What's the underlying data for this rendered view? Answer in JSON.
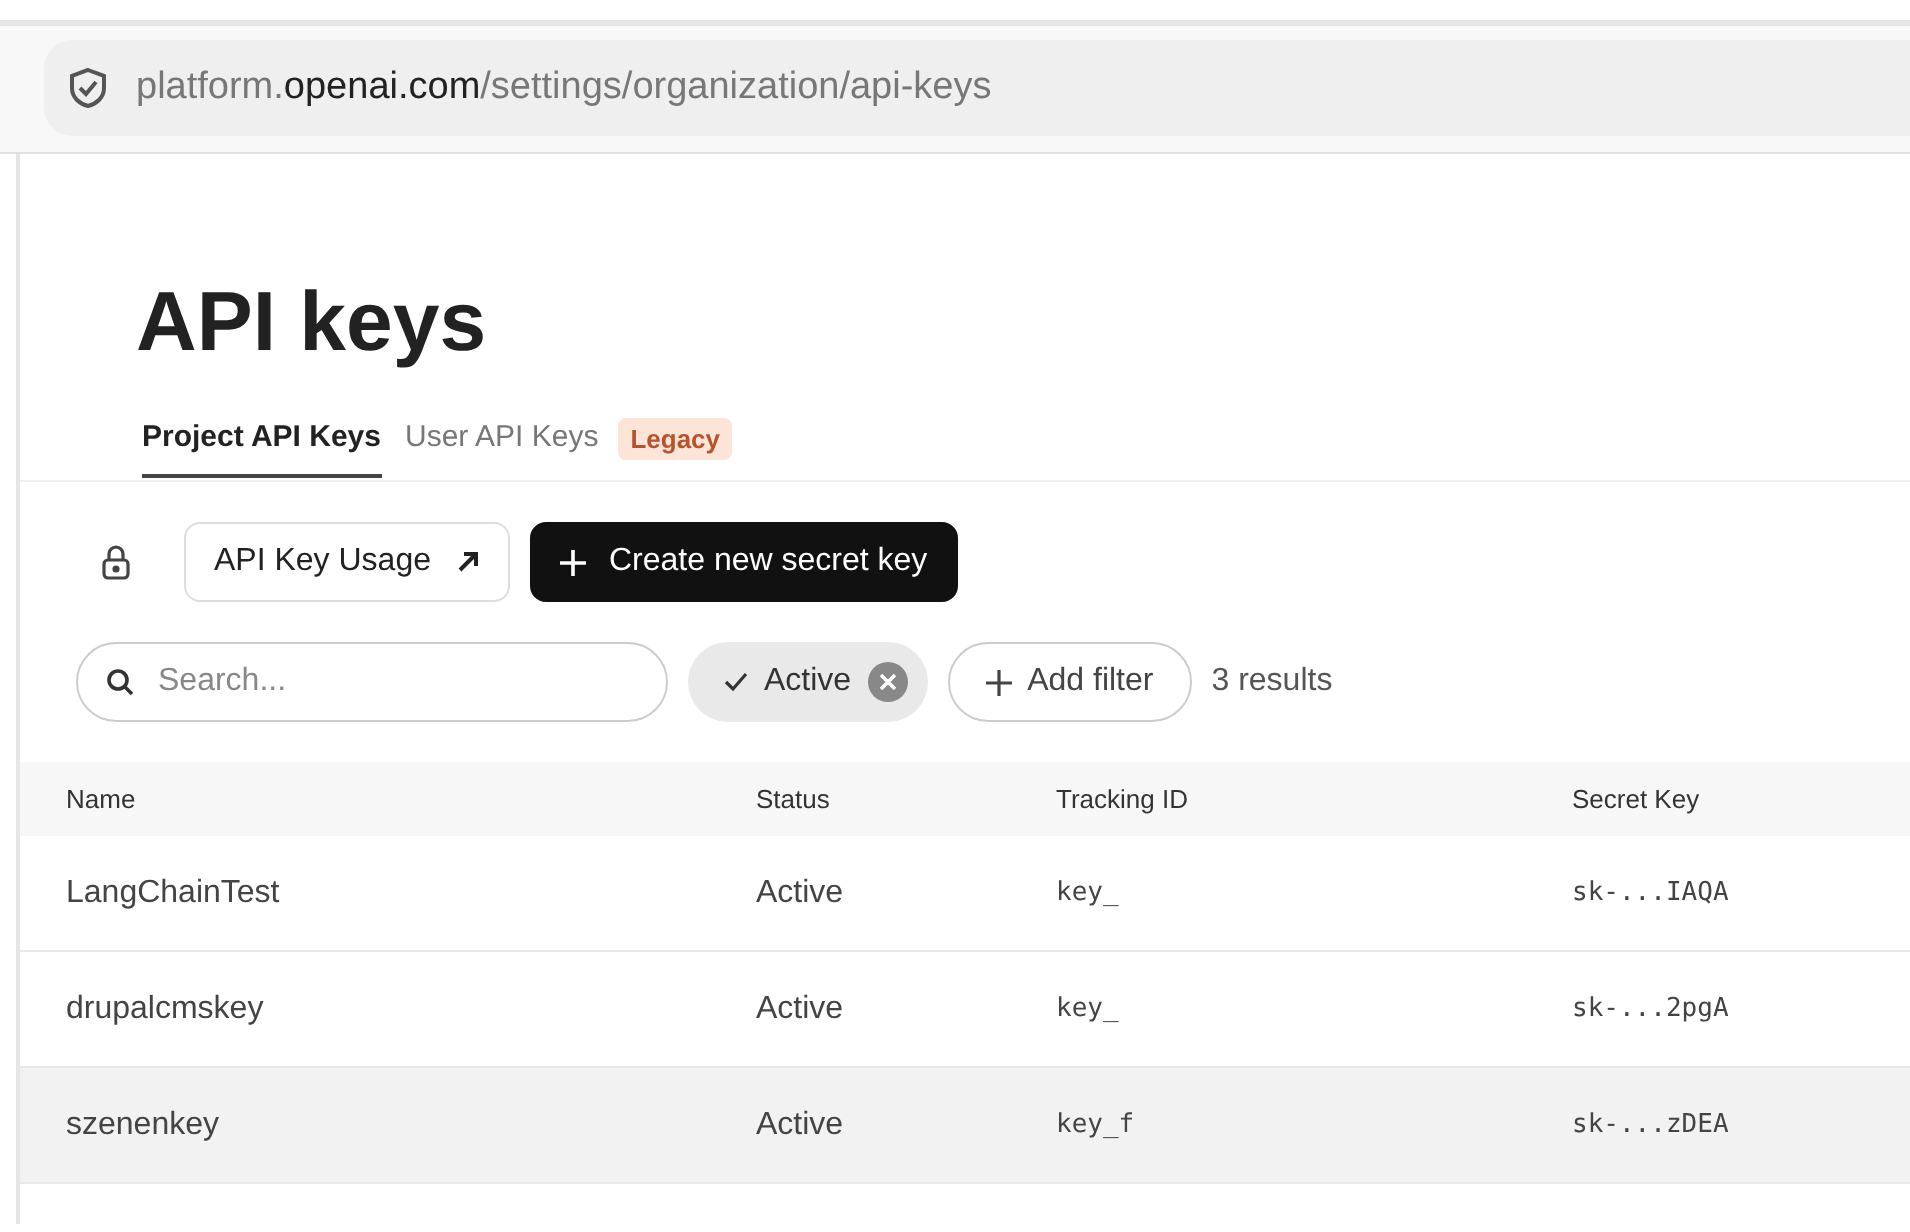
{
  "address_bar": {
    "url": "platform.**openai.com**/settings/organization/api-keys"
  },
  "title": "API keys",
  "tabs": [
    {
      "label": "Project API Keys",
      "selected": true
    },
    {
      "label": "User API Keys",
      "selected": false,
      "badge": "Legacy"
    }
  ],
  "actions": {
    "usage_button": "API Key Usage",
    "create_button": "Create new secret key"
  },
  "filters": {
    "search": {
      "placeholder": "Search..."
    },
    "active_chip": "Active",
    "add_filter": "Add filter",
    "result_count": "3 results"
  },
  "table": {
    "columns": [
      "Name",
      "Status",
      "Tracking ID",
      "Secret Key"
    ],
    "rows": [
      {
        "cells": [
          "LangChainTest",
          "Active",
          "key_",
          "sk-...IAQA"
        ],
        "highlighted": false
      },
      {
        "cells": [
          "drupalcmskey",
          "Active",
          "key_",
          "sk-...2pgA"
        ],
        "highlighted": false
      },
      {
        "cells": [
          "szenenkey",
          "Active",
          "key_f",
          "sk-...zDEA"
        ],
        "highlighted": true
      }
    ]
  }
}
